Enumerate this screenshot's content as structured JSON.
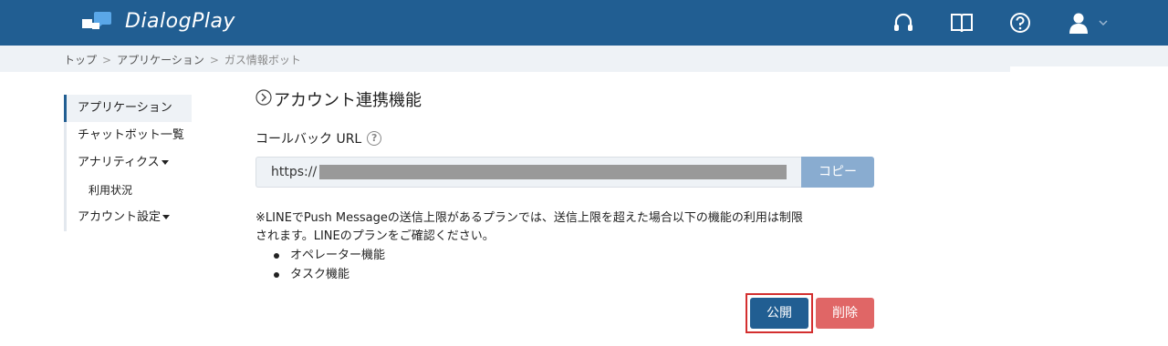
{
  "app": {
    "brand": "DialogPlay"
  },
  "header": {
    "icons": [
      "headset-icon",
      "book-icon",
      "help-icon",
      "user-icon",
      "chevron-down-icon"
    ]
  },
  "breadcrumb": {
    "items": [
      "トップ",
      "アプリケーション",
      "ガス情報ボット"
    ],
    "separator": ">"
  },
  "sidebar": {
    "items": [
      {
        "label": "アプリケーション",
        "active": true
      },
      {
        "label": "チャットボット一覧"
      },
      {
        "label": "アナリティクス",
        "dropdown": true
      },
      {
        "label": "利用状況",
        "sub": true
      },
      {
        "label": "アカウント設定",
        "dropdown": true
      }
    ]
  },
  "main": {
    "section_title": "アカウント連携機能",
    "callback_label": "コールバック URL",
    "url_prefix": "https://",
    "copy_label": "コピー",
    "notice_line1": "※LINEでPush Messageの送信上限があるプランでは、送信上限を超えた場合以下の機能の利用は制限",
    "notice_line2": "されます。LINEのプランをご確認ください。",
    "features": [
      "オペレーター機能",
      "タスク機能"
    ],
    "publish_label": "公開",
    "delete_label": "削除"
  },
  "colors": {
    "header": "#215e92",
    "copy_button": "#89acd0",
    "publish_button": "#215e92",
    "delete_button": "#e06666",
    "highlight_frame": "#d32f2f"
  }
}
